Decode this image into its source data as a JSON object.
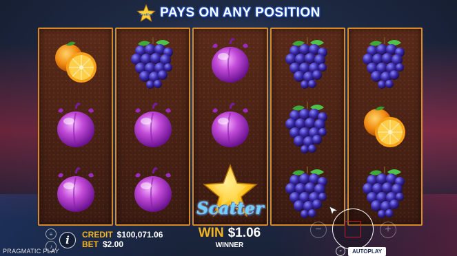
{
  "header": {
    "title": "PAYS ON ANY POSITION",
    "icon": "star-icon"
  },
  "reels": [
    [
      "orange",
      "plum",
      "plum"
    ],
    [
      "grapes",
      "plum",
      "plum"
    ],
    [
      "plum",
      "plum",
      "scatter"
    ],
    [
      "grapes",
      "grapes",
      "grapes"
    ],
    [
      "grapes",
      "orange",
      "grapes"
    ]
  ],
  "scatter_label": "Scatter",
  "panel": {
    "credit_label": "CREDIT",
    "credit_value": "$100,071.06",
    "bet_label": "BET",
    "bet_value": "$2.00",
    "win_label": "WIN",
    "win_value": "$1.06",
    "winner_label": "WINNER",
    "brand": "PRAGMATIC PLAY",
    "info_icon": "i",
    "minus_icon": "−",
    "plus_icon": "+",
    "autoplay_label": "AUTOPLAY",
    "turbo_icon": "»"
  },
  "colors": {
    "reel_border": "#d88a2a",
    "label_gold": "#f5b321",
    "scatter_blue": "#6fd0ff",
    "spin_red": "#c02030"
  }
}
